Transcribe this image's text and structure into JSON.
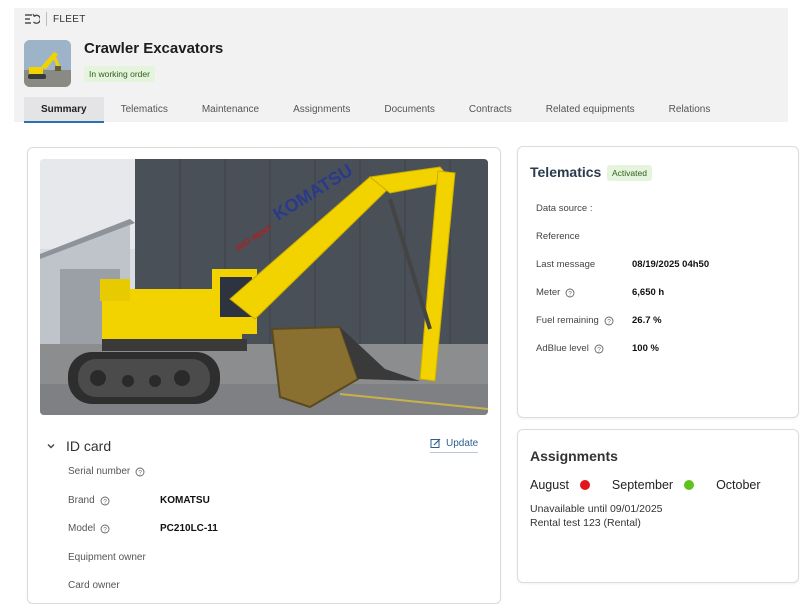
{
  "breadcrumb": {
    "label": "FLEET"
  },
  "asset": {
    "title": "Crawler Excavators",
    "status": "In working order"
  },
  "tabs": [
    {
      "label": "Summary",
      "active": true
    },
    {
      "label": "Telematics"
    },
    {
      "label": "Maintenance"
    },
    {
      "label": "Assignments"
    },
    {
      "label": "Documents"
    },
    {
      "label": "Contracts"
    },
    {
      "label": "Related equipments"
    },
    {
      "label": "Relations"
    }
  ],
  "photo": {
    "brand_text": "KOMATSU",
    "decal_text": "MAT RENT"
  },
  "id_card": {
    "title": "ID card",
    "update_label": "Update",
    "fields": [
      {
        "label": "Serial number",
        "value": "",
        "help": true
      },
      {
        "label": "Brand",
        "value": "KOMATSU",
        "help": true
      },
      {
        "label": "Model",
        "value": "PC210LC-11",
        "help": true
      },
      {
        "label": "Equipment owner",
        "value": "",
        "help": false
      },
      {
        "label": "Card owner",
        "value": "",
        "help": false
      }
    ]
  },
  "telematics": {
    "title": "Telematics",
    "badge": "Activated",
    "rows": [
      {
        "label": "Data source :",
        "value": "",
        "help": false
      },
      {
        "label": "Reference",
        "value": "",
        "help": false
      },
      {
        "label": "Last message",
        "value": "08/19/2025 04h50",
        "help": false
      },
      {
        "label": "Meter",
        "value": "6,650 h",
        "help": true
      },
      {
        "label": "Fuel remaining",
        "value": "26.7 %",
        "help": true
      },
      {
        "label": "AdBlue level",
        "value": "100 %",
        "help": true
      }
    ]
  },
  "assignments": {
    "title": "Assignments",
    "months": [
      {
        "label": "August",
        "dot": "#e3141b"
      },
      {
        "label": "September",
        "dot": "#5fc21e"
      },
      {
        "label": "October",
        "dot": ""
      }
    ],
    "unavailable": "Unavailable until 09/01/2025",
    "rental": "Rental test 123 (Rental)"
  },
  "colors": {
    "accent": "#2d6fb5",
    "badge_bg": "#e5f4dc",
    "excavator_yellow": "#f2d300"
  }
}
